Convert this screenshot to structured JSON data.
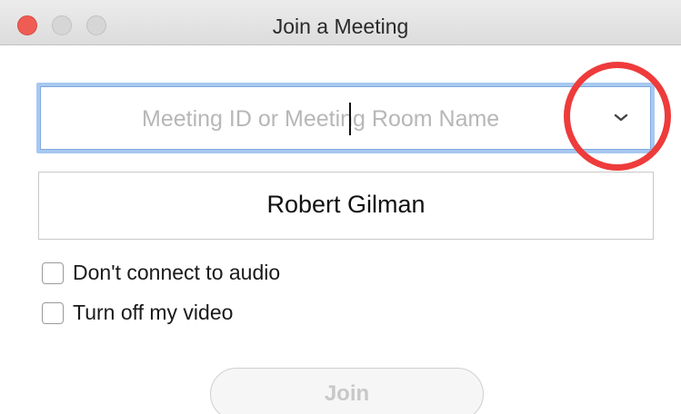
{
  "window": {
    "title": "Join a Meeting"
  },
  "meeting_field": {
    "placeholder": "Meeting ID or Meeting Room Name",
    "value": "",
    "dropdown_icon": "chevron-down-icon"
  },
  "name_field": {
    "value": "Robert Gilman"
  },
  "options": [
    {
      "label": "Don't connect to audio",
      "checked": false
    },
    {
      "label": "Turn off my video",
      "checked": false
    }
  ],
  "join_button": {
    "label": "Join",
    "enabled": false
  },
  "colors": {
    "close_button": "#ee5c54",
    "focus_ring": "#a7c8f0",
    "annotation_circle": "#ee3b3b"
  }
}
